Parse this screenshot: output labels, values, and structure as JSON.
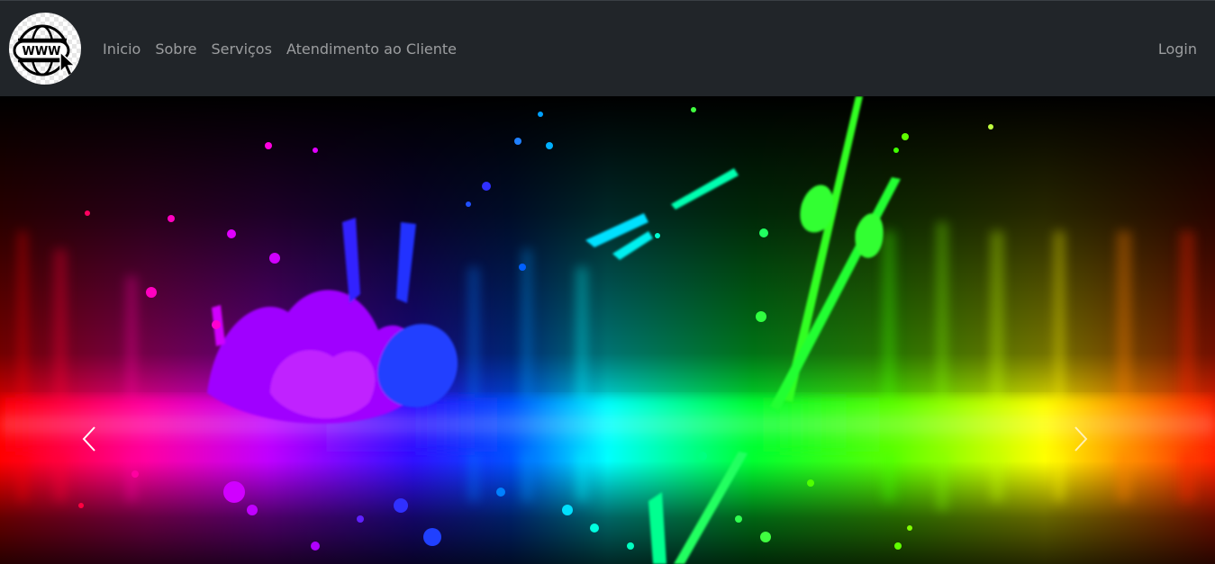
{
  "brand": {
    "logo_icon": "www-globe-cursor-icon",
    "logo_text": "WWW"
  },
  "nav": {
    "items": [
      {
        "label": "Inicio"
      },
      {
        "label": "Sobre"
      },
      {
        "label": "Serviços"
      },
      {
        "label": "Atendimento ao Cliente"
      }
    ],
    "login_label": "Login"
  },
  "carousel": {
    "prev_icon": "chevron-left-icon",
    "next_icon": "chevron-right-icon"
  },
  "colors": {
    "navbar_bg": "#212529",
    "nav_link": "rgba(255,255,255,0.55)"
  }
}
